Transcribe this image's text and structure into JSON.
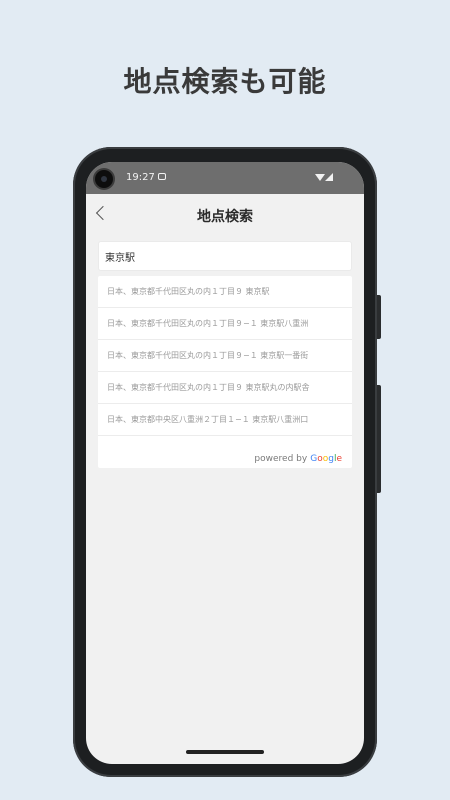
{
  "headline": "地点検索も可能",
  "statusbar": {
    "time": "19:27"
  },
  "appbar": {
    "title": "地点検索"
  },
  "search": {
    "value": "東京駅"
  },
  "results": [
    {
      "text": "日本、東京都千代田区丸の内１丁目９ 東京駅"
    },
    {
      "text": "日本、東京都千代田区丸の内１丁目９−１ 東京駅八重洲"
    },
    {
      "text": "日本、東京都千代田区丸の内１丁目９−１ 東京駅一番街"
    },
    {
      "text": "日本、東京都千代田区丸の内１丁目９ 東京駅丸の内駅舎"
    },
    {
      "text": "日本、東京都中央区八重洲２丁目１−１ 東京駅八重洲口"
    }
  ],
  "powered_by": {
    "label": "powered by",
    "g1": "G",
    "g2": "o",
    "g3": "o",
    "g4": "g",
    "g5": "l",
    "g6": "e"
  },
  "colors": {
    "background": "#e2ebf3",
    "statusbar": "#6e6e6e",
    "google_blue": "#4285f4",
    "google_red": "#ea4335",
    "google_yellow": "#fbbc05",
    "google_green": "#34a853"
  }
}
